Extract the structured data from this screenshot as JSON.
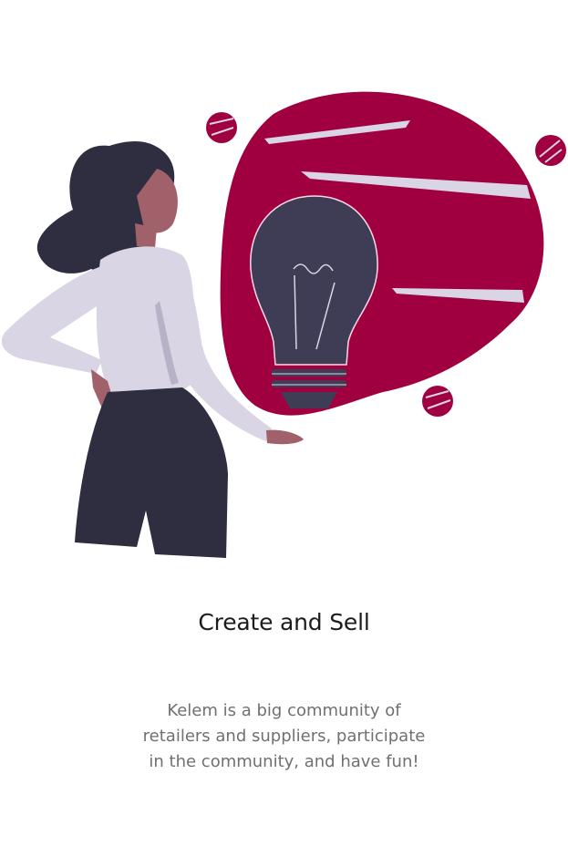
{
  "onboarding": {
    "title": "Create and Sell",
    "description": "Kelem is a big community of retailers and suppliers, participate in the community, and have fun!"
  },
  "illustration": {
    "name": "woman-with-lightbulb-illustration",
    "accent_color": "#a00040",
    "dark_color": "#2f2e41",
    "light_color": "#d9d5e4"
  }
}
